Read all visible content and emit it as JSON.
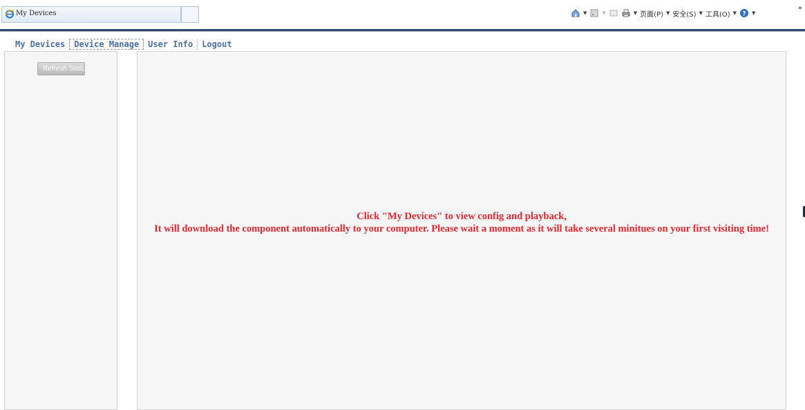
{
  "browser": {
    "tab_title": "My Devices",
    "command_bar": {
      "page_menu": "页面(P)",
      "safety_menu": "安全(S)",
      "tools_menu": "工具(O)",
      "overflow": "»"
    },
    "icons": [
      "ie-icon",
      "home-icon",
      "feeds-icon",
      "read-mail-icon",
      "print-icon",
      "help-icon"
    ]
  },
  "nav": {
    "items": [
      {
        "label": "My Devices"
      },
      {
        "label": "Device Manage",
        "active": true
      },
      {
        "label": "User Info"
      },
      {
        "label": "Logout"
      }
    ]
  },
  "sidebar": {
    "refresh_button": "Refresh Status"
  },
  "main": {
    "message_line1": "Click \"My Devices\" to view config and playback,",
    "message_line2": "It will download the component automatically to your computer. Please wait a moment as it will take several minitues on your first visiting time!"
  },
  "colors": {
    "message": "#e8262d",
    "nav_link": "#4b6fa8",
    "header_rule": "#2f4a6e",
    "pane_bg": "#f6f6f6"
  }
}
